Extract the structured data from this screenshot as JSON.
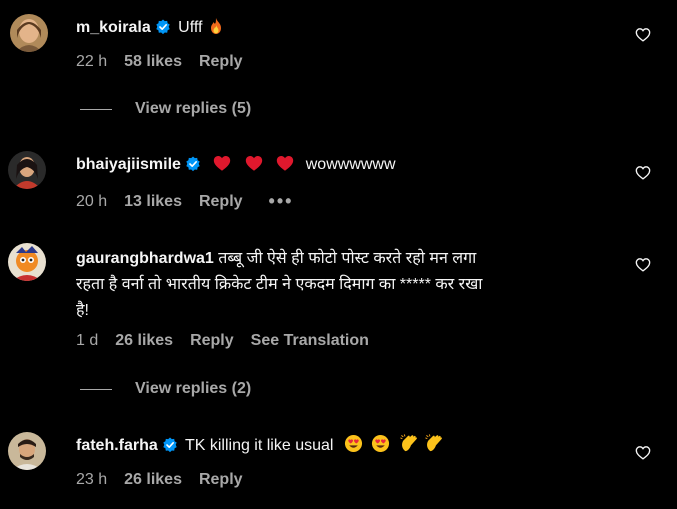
{
  "comments": [
    {
      "username": "m_koirala",
      "text": "Ufff",
      "time": "22 h",
      "likes": "58 likes",
      "reply_label": "Reply",
      "emojis": [
        "fire-emoji"
      ]
    },
    {
      "username": "bhaiyajiismile",
      "text": "wowwwwww",
      "time": "20 h",
      "likes": "13 likes",
      "reply_label": "Reply",
      "more_label": "•••",
      "emojis": [
        "red-heart-emoji",
        "red-heart-emoji",
        "red-heart-emoji"
      ]
    },
    {
      "username": "gaurangbhardwa1",
      "text_line1": "तब्बू जी ऐसे ही फोटो पोस्ट करते रहो मन लगा",
      "text_line2": "रहता है वर्ना तो भारतीय क्रिकेट टीम ने एकदम दिमाग का ***** कर रखा",
      "text_line3": "है!",
      "time": "1 d",
      "likes": "26 likes",
      "reply_label": "Reply",
      "translation_label": "See Translation"
    },
    {
      "username": "fateh.farha",
      "text": "TK killing it like usual",
      "time": "23 h",
      "likes": "26 likes",
      "reply_label": "Reply",
      "emojis": [
        "heart-eyes-emoji",
        "heart-eyes-emoji",
        "clapping-hands-emoji",
        "clapping-hands-emoji"
      ]
    }
  ],
  "view_replies": [
    "View replies (5)",
    "View replies (2)"
  ],
  "colors": {
    "background": "#000000",
    "text": "#f5f5f5",
    "meta": "#a8a8a8",
    "verified": "#0095f6",
    "heart_emoji": "#e0182d"
  }
}
